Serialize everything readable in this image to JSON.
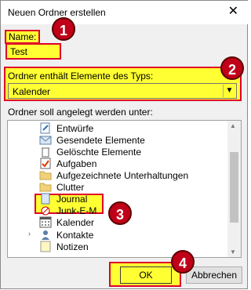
{
  "window": {
    "title": "Neuen Ordner erstellen"
  },
  "name": {
    "label": "Name:",
    "value": "Test"
  },
  "type": {
    "label": "Ordner enthält Elemente des Typs:",
    "selected": "Kalender"
  },
  "location": {
    "label": "Ordner soll angelegt werden unter:"
  },
  "tree": [
    {
      "label": "Entwürfe",
      "icon": "drafts-icon"
    },
    {
      "label": "Gesendete Elemente",
      "icon": "sent-icon"
    },
    {
      "label": "Gelöschte Elemente",
      "icon": "trash-icon"
    },
    {
      "label": "Aufgaben",
      "icon": "tasks-icon"
    },
    {
      "label": "Aufgezeichnete Unterhaltungen",
      "icon": "folder-icon"
    },
    {
      "label": "Clutter",
      "icon": "folder-icon"
    },
    {
      "label": "Journal",
      "icon": "journal-icon"
    },
    {
      "label": "Junk-E-M",
      "icon": "junk-icon"
    },
    {
      "label": "Kalender",
      "icon": "calendar-icon"
    },
    {
      "label": "Kontakte",
      "icon": "contacts-icon"
    },
    {
      "label": "Notizen",
      "icon": "notes-icon"
    }
  ],
  "buttons": {
    "ok": "OK",
    "cancel": "Abbrechen"
  },
  "badges": [
    "1",
    "2",
    "3",
    "4"
  ],
  "colors": {
    "highlight": "#ffff33",
    "annotation": "#e0002a"
  }
}
